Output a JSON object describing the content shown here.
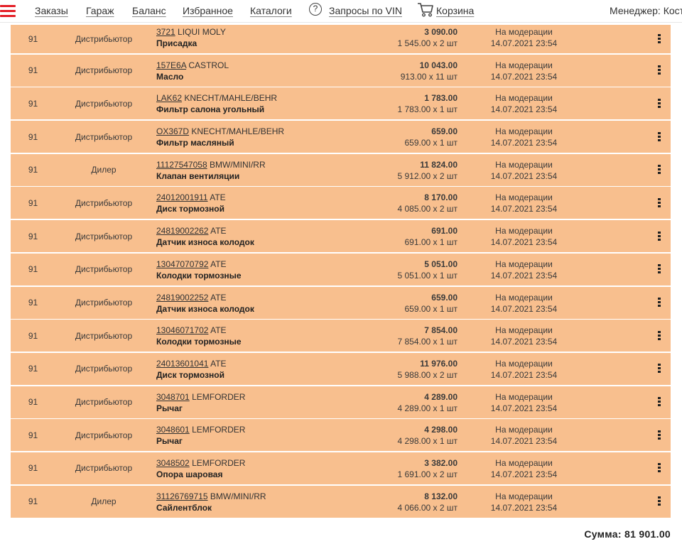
{
  "nav": {
    "items": [
      "Заказы",
      "Гараж",
      "Баланс",
      "Избранное",
      "Каталоги",
      "Запросы по VIN",
      "Корзина"
    ],
    "manager": "Менеджер: Кост"
  },
  "rows": [
    {
      "qty": "91",
      "type": "Дистрибьютор",
      "article": "3721",
      "brand": "LIQUI MOLY",
      "name": "Присадка",
      "total": "3 090.00",
      "unit": "1 545.00 x 2 шт",
      "status": "На модерации",
      "date": "14.07.2021 23:54"
    },
    {
      "qty": "91",
      "type": "Дистрибьютор",
      "article": "157E6A",
      "brand": "CASTROL",
      "name": "Масло",
      "total": "10 043.00",
      "unit": "913.00 x 11 шт",
      "status": "На модерации",
      "date": "14.07.2021 23:54"
    },
    {
      "qty": "91",
      "type": "Дистрибьютор",
      "article": "LAK62",
      "brand": "KNECHT/MAHLE/BEHR",
      "name": "Фильтр салона угольный",
      "total": "1 783.00",
      "unit": "1 783.00 x 1 шт",
      "status": "На модерации",
      "date": "14.07.2021 23:54"
    },
    {
      "qty": "91",
      "type": "Дистрибьютор",
      "article": "OX367D",
      "brand": "KNECHT/MAHLE/BEHR",
      "name": "Фильтр масляный",
      "total": "659.00",
      "unit": "659.00 x 1 шт",
      "status": "На модерации",
      "date": "14.07.2021 23:54"
    },
    {
      "qty": "91",
      "type": "Дилер",
      "article": "11127547058",
      "brand": "BMW/MINI/RR",
      "name": "Клапан вентиляции",
      "total": "11 824.00",
      "unit": "5 912.00 x 2 шт",
      "status": "На модерации",
      "date": "14.07.2021 23:54"
    },
    {
      "qty": "91",
      "type": "Дистрибьютор",
      "article": "24012001911",
      "brand": "ATE",
      "name": "Диск тормозной",
      "total": "8 170.00",
      "unit": "4 085.00 x 2 шт",
      "status": "На модерации",
      "date": "14.07.2021 23:54"
    },
    {
      "qty": "91",
      "type": "Дистрибьютор",
      "article": "24819002262",
      "brand": "ATE",
      "name": "Датчик износа колодок",
      "total": "691.00",
      "unit": "691.00 x 1 шт",
      "status": "На модерации",
      "date": "14.07.2021 23:54"
    },
    {
      "qty": "91",
      "type": "Дистрибьютор",
      "article": "13047070792",
      "brand": "ATE",
      "name": "Колодки тормозные",
      "total": "5 051.00",
      "unit": "5 051.00 x 1 шт",
      "status": "На модерации",
      "date": "14.07.2021 23:54"
    },
    {
      "qty": "91",
      "type": "Дистрибьютор",
      "article": "24819002252",
      "brand": "ATE",
      "name": "Датчик износа колодок",
      "total": "659.00",
      "unit": "659.00 x 1 шт",
      "status": "На модерации",
      "date": "14.07.2021 23:54"
    },
    {
      "qty": "91",
      "type": "Дистрибьютор",
      "article": "13046071702",
      "brand": "ATE",
      "name": "Колодки тормозные",
      "total": "7 854.00",
      "unit": "7 854.00 x 1 шт",
      "status": "На модерации",
      "date": "14.07.2021 23:54"
    },
    {
      "qty": "91",
      "type": "Дистрибьютор",
      "article": "24013601041",
      "brand": "ATE",
      "name": "Диск тормозной",
      "total": "11 976.00",
      "unit": "5 988.00 x 2 шт",
      "status": "На модерации",
      "date": "14.07.2021 23:54"
    },
    {
      "qty": "91",
      "type": "Дистрибьютор",
      "article": "3048701",
      "brand": "LEMFORDER",
      "name": "Рычаг",
      "total": "4 289.00",
      "unit": "4 289.00 x 1 шт",
      "status": "На модерации",
      "date": "14.07.2021 23:54"
    },
    {
      "qty": "91",
      "type": "Дистрибьютор",
      "article": "3048601",
      "brand": "LEMFORDER",
      "name": "Рычаг",
      "total": "4 298.00",
      "unit": "4 298.00 x 1 шт",
      "status": "На модерации",
      "date": "14.07.2021 23:54"
    },
    {
      "qty": "91",
      "type": "Дистрибьютор",
      "article": "3048502",
      "brand": "LEMFORDER",
      "name": "Опора шаровая",
      "total": "3 382.00",
      "unit": "1 691.00 x 2 шт",
      "status": "На модерации",
      "date": "14.07.2021 23:54"
    },
    {
      "qty": "91",
      "type": "Дилер",
      "article": "31126769715",
      "brand": "BMW/MINI/RR",
      "name": "Сайлентблок",
      "total": "8 132.00",
      "unit": "4 066.00 x 2 шт",
      "status": "На модерации",
      "date": "14.07.2021 23:54"
    }
  ],
  "summary": "Сумма: 81 901.00"
}
